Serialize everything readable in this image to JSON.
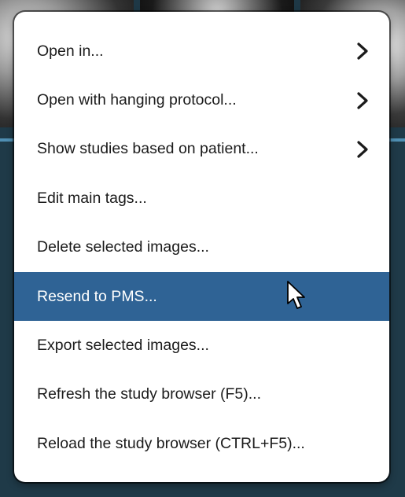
{
  "menu": {
    "items": [
      {
        "label": "Open in...",
        "has_submenu": true,
        "selected": false
      },
      {
        "label": "Open with hanging protocol...",
        "has_submenu": true,
        "selected": false
      },
      {
        "label": "Show studies based on patient...",
        "has_submenu": true,
        "selected": false
      },
      {
        "label": "Edit main tags...",
        "has_submenu": false,
        "selected": false
      },
      {
        "label": "Delete selected images...",
        "has_submenu": false,
        "selected": false
      },
      {
        "label": "Resend to PMS...",
        "has_submenu": false,
        "selected": true
      },
      {
        "label": "Export selected images...",
        "has_submenu": false,
        "selected": false
      },
      {
        "label": "Refresh the study browser (F5)...",
        "has_submenu": false,
        "selected": false
      },
      {
        "label": "Reload the study browser (CTRL+F5)...",
        "has_submenu": false,
        "selected": false
      }
    ],
    "icons": {
      "submenu": "chevron-right-icon",
      "pointer": "mouse-pointer-icon"
    }
  },
  "colors": {
    "background": "#1f3a48",
    "accent_line": "#4f8fb3",
    "highlight": "#2f6395",
    "menu_background": "#ffffff",
    "text": "#1b1b1b"
  }
}
